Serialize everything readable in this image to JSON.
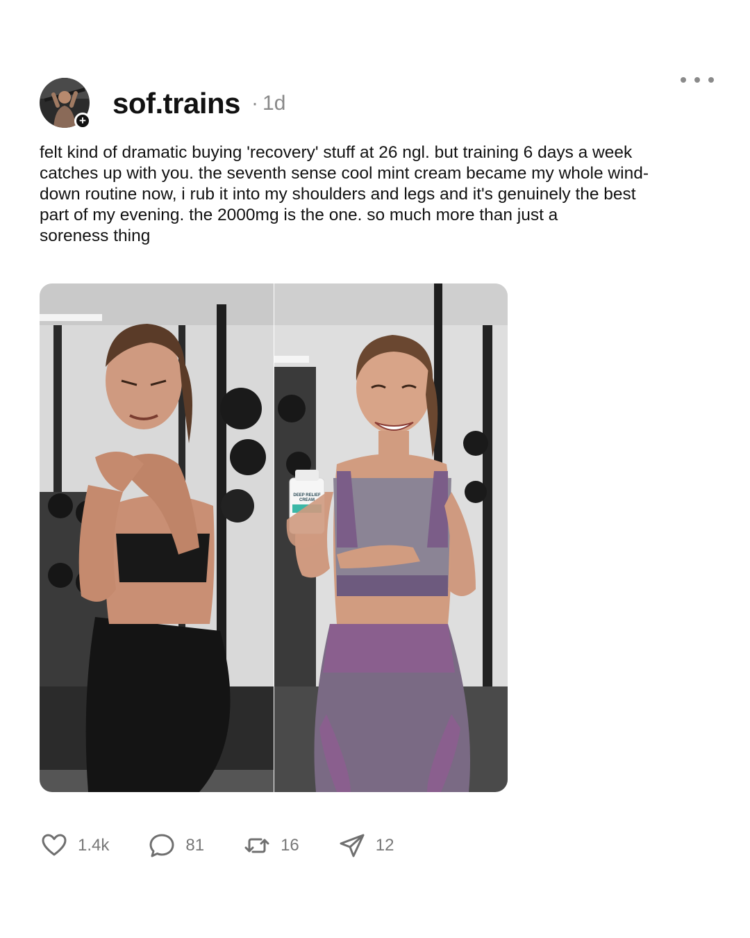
{
  "post": {
    "username": "sof.trains",
    "separator": "·",
    "time": "1d",
    "follow_symbol": "+",
    "text": "felt kind of dramatic buying 'recovery' stuff at 26 ngl. but training 6 days a week\ncatches up with you. the seventh sense cool mint cream became my whole wind-\ndown routine now, i rub it into my shoulders and legs and it's genuinely the best\npart of my evening. the 2000mg is the one. so much more than just a\nsoreness thing",
    "product_label": {
      "line1": "DEEP RELIEF",
      "line2": "CREAM"
    }
  },
  "actions": {
    "likes": "1.4k",
    "comments": "81",
    "reposts": "16",
    "shares": "12"
  },
  "icons": {
    "more": "more-horizontal-icon",
    "like": "heart-icon",
    "comment": "comment-bubble-icon",
    "repost": "repost-icon",
    "share": "send-icon"
  },
  "colors": {
    "text": "#111111",
    "muted": "#888888",
    "action_count": "#777777",
    "icon": "#6f6f6f"
  }
}
